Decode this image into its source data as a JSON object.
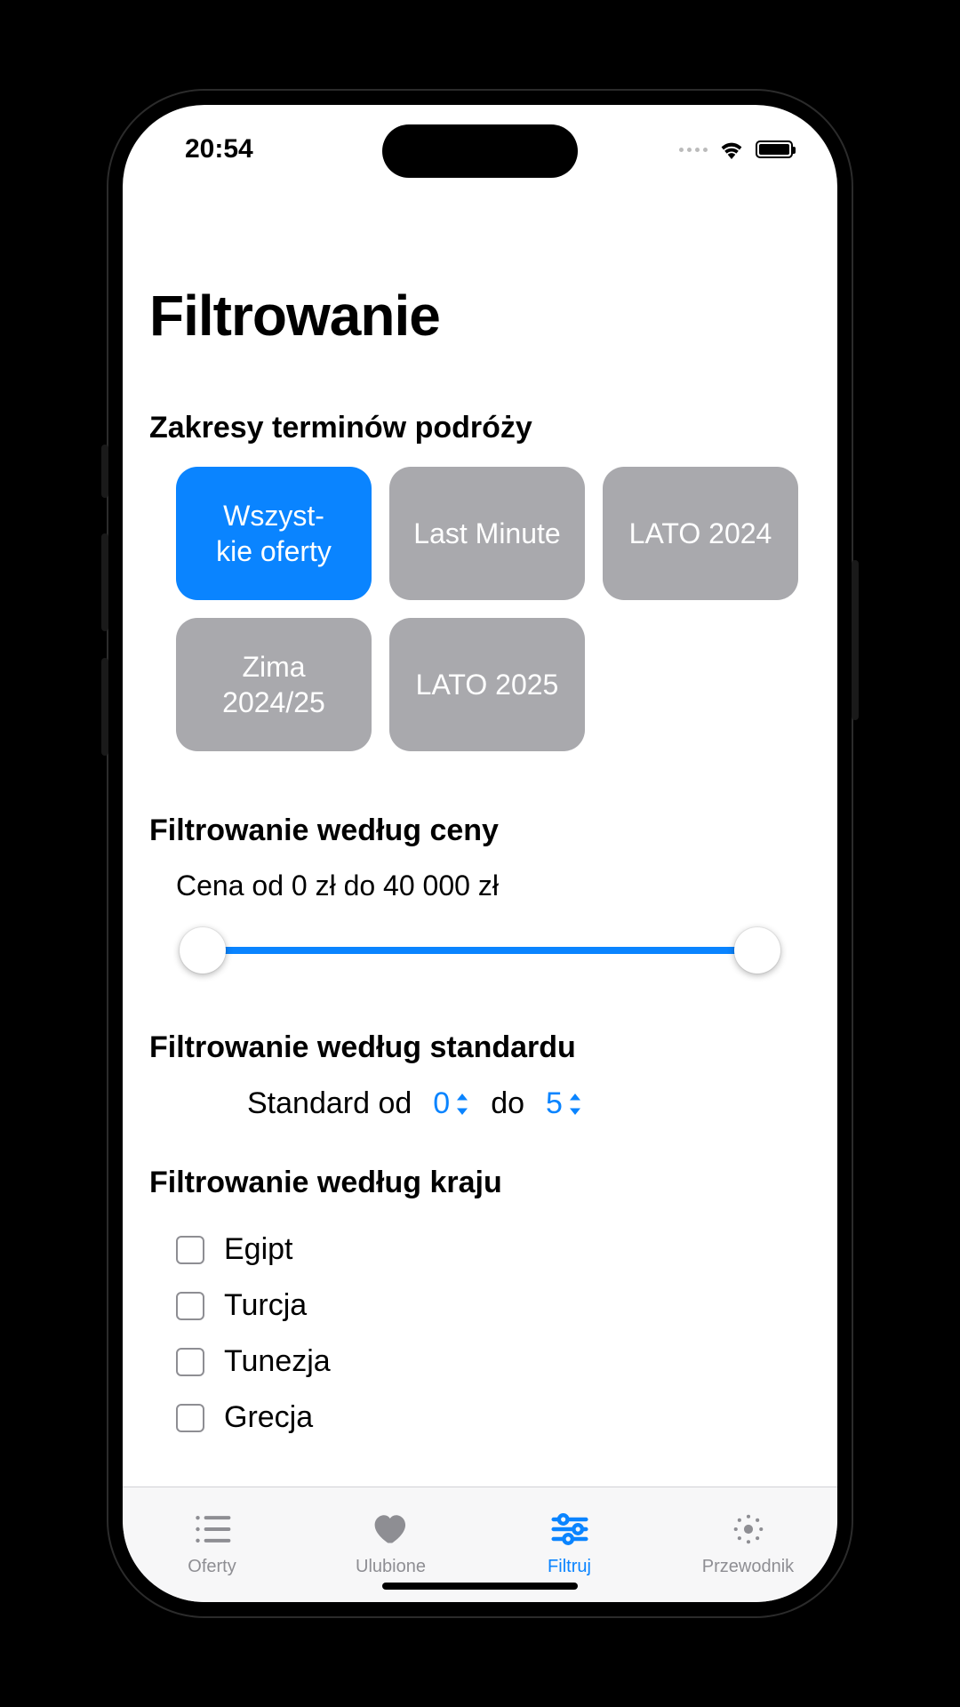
{
  "status": {
    "time": "20:54"
  },
  "title": "Filtrowanie",
  "sections": {
    "date_ranges": {
      "heading": "Zakresy terminów podróży",
      "chips": [
        {
          "label": "Wszyst-\nkie oferty",
          "selected": true
        },
        {
          "label": "Last Minute",
          "selected": false
        },
        {
          "label": "LATO 2024",
          "selected": false
        },
        {
          "label": "Zima 2024/25",
          "selected": false
        },
        {
          "label": "LATO 2025",
          "selected": false
        }
      ]
    },
    "price": {
      "heading": "Filtrowanie według ceny",
      "range_label": "Cena od 0 zł do 40 000 zł",
      "min": 0,
      "max": 40000
    },
    "standard": {
      "heading": "Filtrowanie według standardu",
      "label_from": "Standard od",
      "from_value": "0",
      "label_to": "do",
      "to_value": "5"
    },
    "country": {
      "heading": "Filtrowanie według kraju",
      "items": [
        "Egipt",
        "Turcja",
        "Tunezja",
        "Grecja"
      ]
    }
  },
  "tabs": [
    {
      "label": "Oferty",
      "active": false
    },
    {
      "label": "Ulubione",
      "active": false
    },
    {
      "label": "Filtruj",
      "active": true
    },
    {
      "label": "Przewodnik",
      "active": false
    }
  ]
}
